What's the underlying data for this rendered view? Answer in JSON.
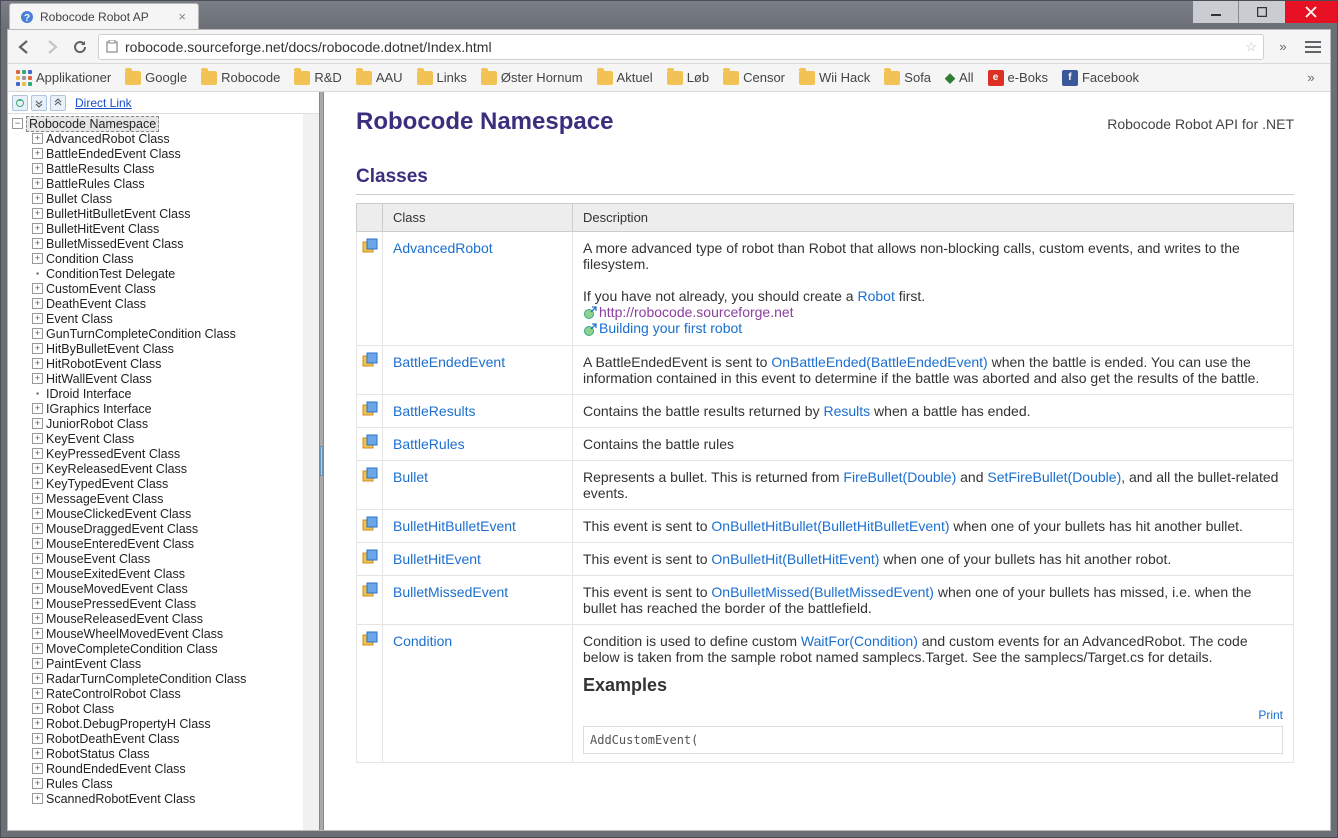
{
  "window": {
    "tab_title": "Robocode Robot AP",
    "url": "robocode.sourceforge.net/docs/robocode.dotnet/Index.html"
  },
  "bookmarks": {
    "apps": "Applikationer",
    "items": [
      "Google",
      "Robocode",
      "R&D",
      "AAU",
      "Links",
      "Øster Hornum",
      "Aktuel",
      "Løb",
      "Censor",
      "Wii Hack",
      "Sofa"
    ],
    "all": "All",
    "eboks": "e-Boks",
    "facebook": "Facebook"
  },
  "tree": {
    "direct_link": "Direct Link",
    "root": "Robocode Namespace",
    "items": [
      {
        "t": "AdvancedRobot Class",
        "e": "+"
      },
      {
        "t": "BattleEndedEvent Class",
        "e": "+"
      },
      {
        "t": "BattleResults Class",
        "e": "+"
      },
      {
        "t": "BattleRules Class",
        "e": "+"
      },
      {
        "t": "Bullet Class",
        "e": "+"
      },
      {
        "t": "BulletHitBulletEvent Class",
        "e": "+"
      },
      {
        "t": "BulletHitEvent Class",
        "e": "+"
      },
      {
        "t": "BulletMissedEvent Class",
        "e": "+"
      },
      {
        "t": "Condition Class",
        "e": "+"
      },
      {
        "t": "ConditionTest Delegate",
        "e": "."
      },
      {
        "t": "CustomEvent Class",
        "e": "+"
      },
      {
        "t": "DeathEvent Class",
        "e": "+"
      },
      {
        "t": "Event Class",
        "e": "+"
      },
      {
        "t": "GunTurnCompleteCondition Class",
        "e": "+"
      },
      {
        "t": "HitByBulletEvent Class",
        "e": "+"
      },
      {
        "t": "HitRobotEvent Class",
        "e": "+"
      },
      {
        "t": "HitWallEvent Class",
        "e": "+"
      },
      {
        "t": "IDroid Interface",
        "e": "."
      },
      {
        "t": "IGraphics Interface",
        "e": "+"
      },
      {
        "t": "JuniorRobot Class",
        "e": "+"
      },
      {
        "t": "KeyEvent Class",
        "e": "+"
      },
      {
        "t": "KeyPressedEvent Class",
        "e": "+"
      },
      {
        "t": "KeyReleasedEvent Class",
        "e": "+"
      },
      {
        "t": "KeyTypedEvent Class",
        "e": "+"
      },
      {
        "t": "MessageEvent Class",
        "e": "+"
      },
      {
        "t": "MouseClickedEvent Class",
        "e": "+"
      },
      {
        "t": "MouseDraggedEvent Class",
        "e": "+"
      },
      {
        "t": "MouseEnteredEvent Class",
        "e": "+"
      },
      {
        "t": "MouseEvent Class",
        "e": "+"
      },
      {
        "t": "MouseExitedEvent Class",
        "e": "+"
      },
      {
        "t": "MouseMovedEvent Class",
        "e": "+"
      },
      {
        "t": "MousePressedEvent Class",
        "e": "+"
      },
      {
        "t": "MouseReleasedEvent Class",
        "e": "+"
      },
      {
        "t": "MouseWheelMovedEvent Class",
        "e": "+"
      },
      {
        "t": "MoveCompleteCondition Class",
        "e": "+"
      },
      {
        "t": "PaintEvent Class",
        "e": "+"
      },
      {
        "t": "RadarTurnCompleteCondition Class",
        "e": "+"
      },
      {
        "t": "RateControlRobot Class",
        "e": "+"
      },
      {
        "t": "Robot Class",
        "e": "+"
      },
      {
        "t": "Robot.DebugPropertyH Class",
        "e": "+"
      },
      {
        "t": "RobotDeathEvent Class",
        "e": "+"
      },
      {
        "t": "RobotStatus Class",
        "e": "+"
      },
      {
        "t": "RoundEndedEvent Class",
        "e": "+"
      },
      {
        "t": "Rules Class",
        "e": "+"
      },
      {
        "t": "ScannedRobotEvent Class",
        "e": "+"
      }
    ]
  },
  "main": {
    "title": "Robocode Namespace",
    "subtitle": "Robocode Robot API for .NET",
    "section": "Classes",
    "col_class": "Class",
    "col_desc": "Description",
    "rows": [
      {
        "name": "AdvancedRobot",
        "desc_pre": "A more advanced type of robot than Robot that allows non-blocking calls, custom events, and writes to the filesystem.",
        "desc_mid": "If you have not already, you should create a ",
        "link1": "Robot",
        "desc_mid2": " first.",
        "extlink": "http://robocode.sourceforge.net",
        "extlink2": "Building your first robot"
      },
      {
        "name": "BattleEndedEvent",
        "parts": [
          {
            "t": "A BattleEndedEvent is sent to "
          },
          {
            "a": "OnBattleEnded(BattleEndedEvent)"
          },
          {
            "t": " when the battle is ended. You can use the information contained in this event to determine if the battle was aborted and also get the results of the battle."
          }
        ]
      },
      {
        "name": "BattleResults",
        "parts": [
          {
            "t": "Contains the battle results returned by "
          },
          {
            "a": "Results"
          },
          {
            "t": " when a battle has ended."
          }
        ]
      },
      {
        "name": "BattleRules",
        "parts": [
          {
            "t": "Contains the battle rules"
          }
        ]
      },
      {
        "name": "Bullet",
        "parts": [
          {
            "t": "Represents a bullet. This is returned from "
          },
          {
            "a": "FireBullet(Double)"
          },
          {
            "t": " and "
          },
          {
            "a": "SetFireBullet(Double)"
          },
          {
            "t": ", and all the bullet-related events."
          }
        ]
      },
      {
        "name": "BulletHitBulletEvent",
        "parts": [
          {
            "t": "This event is sent to "
          },
          {
            "a": "OnBulletHitBullet(BulletHitBulletEvent)"
          },
          {
            "t": " when one of your bullets has hit another bullet."
          }
        ]
      },
      {
        "name": "BulletHitEvent",
        "parts": [
          {
            "t": "This event is sent to "
          },
          {
            "a": "OnBulletHit(BulletHitEvent)"
          },
          {
            "t": " when one of your bullets has hit another robot."
          }
        ]
      },
      {
        "name": "BulletMissedEvent",
        "parts": [
          {
            "t": "This event is sent to "
          },
          {
            "a": "OnBulletMissed(BulletMissedEvent)"
          },
          {
            "t": " when one of your bullets has missed, i.e. when the bullet has reached the border of the battlefield."
          }
        ]
      },
      {
        "name": "Condition",
        "parts": [
          {
            "t": "Condition is used to define custom "
          },
          {
            "a": "WaitFor(Condition)"
          },
          {
            "t": " and custom events for an AdvancedRobot. The code below is taken from the sample robot named samplecs.Target. See the samplecs/Target.cs for details."
          }
        ],
        "examples": true
      }
    ],
    "examples_label": "Examples",
    "print": "Print",
    "codeline": "AddCustomEvent("
  }
}
